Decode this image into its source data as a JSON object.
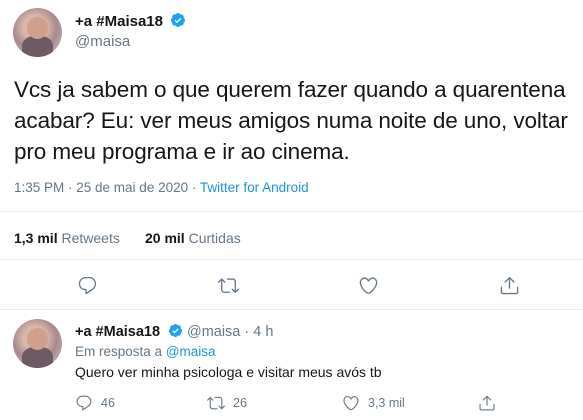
{
  "tweet": {
    "display_name": "+a #Maisa18",
    "handle": "@maisa",
    "text_lines": [
      "Vcs ja sabem o que querem fazer quando a quarentena",
      "acabar? Eu: ver meus amigos numa noite de uno, voltar",
      "pro meu programa e ir ao cinema."
    ],
    "timestamp": "1:35 PM · 25 de mai de 2020 · ",
    "source": "Twitter for Android",
    "retweets_count": "1,3 mil",
    "retweets_label": "Retweets",
    "likes_count": "20 mil",
    "likes_label": "Curtidas"
  },
  "reply": {
    "display_name": "+a #Maisa18",
    "handle_time": "@maisa · 4 h",
    "in_reply_prefix": "Em resposta a ",
    "in_reply_to": "@maisa",
    "text": "Quero ver minha psicologa e visitar meus avós tb",
    "reply_count": "46",
    "retweet_count": "26",
    "like_count": "3,3 mil"
  },
  "colors": {
    "accent": "#1b95e0",
    "verified": "#1da1f2",
    "secondary_text": "#657786",
    "divider": "#e6ecf0"
  },
  "icons": {
    "verified": "verified-badge-icon",
    "reply": "reply-icon",
    "retweet": "retweet-icon",
    "like": "like-icon",
    "share": "share-icon"
  }
}
